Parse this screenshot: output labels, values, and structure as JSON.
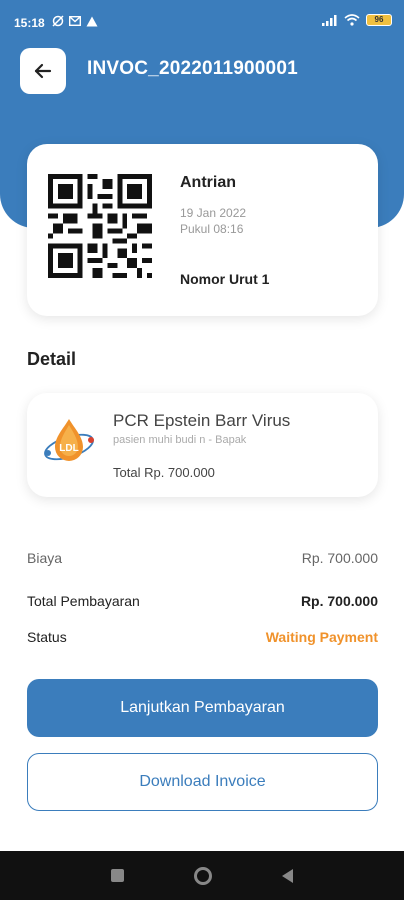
{
  "statusbar": {
    "time": "15:18",
    "battery": "96"
  },
  "header": {
    "title": "INVOC_2022011900001",
    "back_icon": "arrow-left-icon"
  },
  "queue": {
    "title": "Antrian",
    "date": "19 Jan 2022",
    "time": "Pukul 08:16",
    "number": "Nomor Urut 1"
  },
  "detail": {
    "section_title": "Detail",
    "logo_text": "LDL",
    "item_name": "PCR Epstein Barr Virus",
    "patient": "pasien muhi budi n - Bapak",
    "total": "Total Rp. 700.000"
  },
  "summary": {
    "biaya_label": "Biaya",
    "biaya_value": "Rp. 700.000",
    "total_label": "Total Pembayaran",
    "total_value": "Rp. 700.000",
    "status_label": "Status",
    "status_value": "Waiting Payment"
  },
  "actions": {
    "pay_label": "Lanjutkan Pembayaran",
    "download_label": "Download Invoice"
  },
  "colors": {
    "primary": "#3b7dbc",
    "status_waiting": "#f0922b"
  }
}
